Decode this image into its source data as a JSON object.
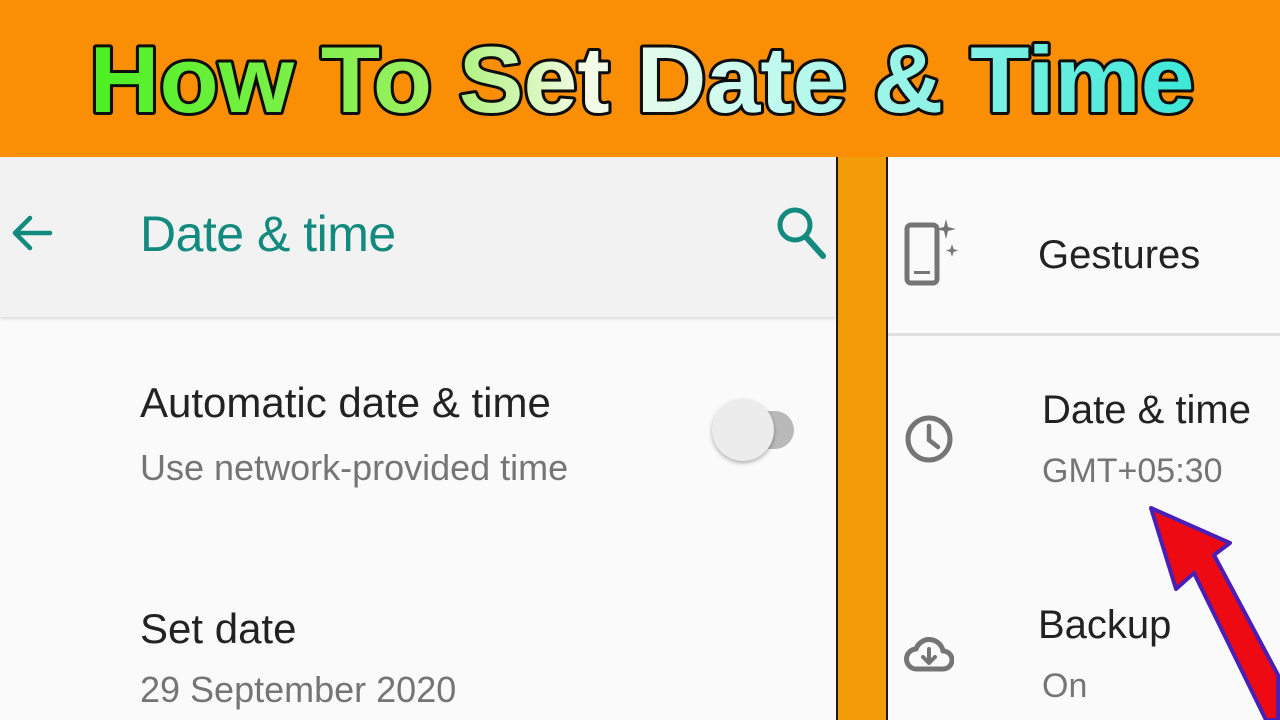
{
  "banner": {
    "title": "How To Set Date & Time"
  },
  "appbar": {
    "title": "Date & time"
  },
  "settings": {
    "automatic": {
      "title": "Automatic date & time",
      "subtitle": "Use network-provided time",
      "toggle_state": "off"
    },
    "set_date": {
      "title": "Set date",
      "value": "29 September 2020"
    }
  },
  "right_menu": {
    "items": [
      {
        "label": "Gestures",
        "icon": "gestures-phone-icon"
      },
      {
        "label": "Date & time",
        "sublabel": "GMT+05:30",
        "icon": "clock-icon"
      },
      {
        "label": "Backup",
        "sublabel": "On",
        "icon": "cloud-backup-icon"
      }
    ]
  },
  "colors": {
    "banner_bg": "#fa8f06",
    "accent_teal": "#138a7e",
    "divider": "#f39c09",
    "arrow_red": "#ee0a12"
  }
}
